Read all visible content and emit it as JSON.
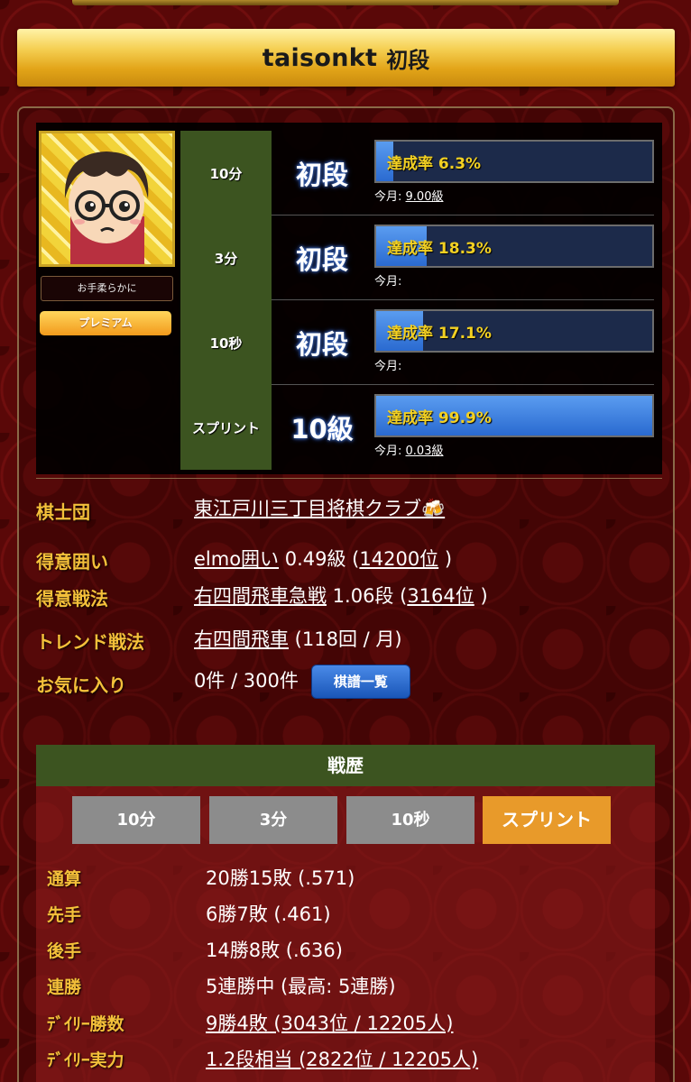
{
  "header": {
    "username": "taisonkt",
    "rank": "初段"
  },
  "profile": {
    "avatar_icon": "avatar-icon",
    "motto": "お手柔らかに",
    "premium_label": "プレミアム"
  },
  "modes": [
    {
      "name": "10分",
      "rank": "初段",
      "progress_label": "達成率 6.3%",
      "progress": 0.063,
      "month_label": "今月:",
      "month_value": "9.00級"
    },
    {
      "name": "3分",
      "rank": "初段",
      "progress_label": "達成率 18.3%",
      "progress": 0.183,
      "month_label": "今月:",
      "month_value": ""
    },
    {
      "name": "10秒",
      "rank": "初段",
      "progress_label": "達成率 17.1%",
      "progress": 0.171,
      "month_label": "今月:",
      "month_value": ""
    },
    {
      "name": "スプリント",
      "rank": "10級",
      "progress_label": "達成率 99.9%",
      "progress": 0.999,
      "month_label": "今月:",
      "month_value": "0.03級"
    }
  ],
  "info": {
    "club_label": "棋士団",
    "club_value": "東江戸川三丁目将棋クラブ🍻",
    "castle_label": "得意囲い",
    "castle_name": "elmo囲い",
    "castle_grade": " 0.49級 (",
    "castle_rank": "14200位",
    "castle_close": " )",
    "strategy_label": "得意戦法",
    "strategy_name": "右四間飛車急戦",
    "strategy_grade": " 1.06段 (",
    "strategy_rank": "3164位",
    "strategy_close": " )",
    "trend_label": "トレンド戦法",
    "trend_name": "右四間飛車",
    "trend_count": " (118回 / 月)",
    "favorites_label": "お気に入り",
    "favorites_value": "0件 / 300件",
    "kifu_button": "棋譜一覧"
  },
  "record": {
    "title": "戦歴",
    "tabs": [
      "10分",
      "3分",
      "10秒",
      "スプリント"
    ],
    "active_tab": "スプリント",
    "rows": [
      {
        "label": "通算",
        "value": "20勝15敗 (.571)"
      },
      {
        "label": "先手",
        "value": "6勝7敗 (.461)"
      },
      {
        "label": "後手",
        "value": "14勝8敗 (.636)"
      },
      {
        "label": "連勝",
        "value": "5連勝中 (最高: 5連勝)"
      },
      {
        "label": "ﾃﾞｲﾘｰ勝数",
        "value": "9勝4敗 (3043位 / 12205人)"
      },
      {
        "label": "ﾃﾞｲﾘｰ実力",
        "value": "1.2段相当 (2822位 / 12205人)"
      }
    ]
  },
  "colors": {
    "gold": "#f4c03a",
    "panel_green": "#3c5420",
    "active_tab": "#e89a2a"
  }
}
